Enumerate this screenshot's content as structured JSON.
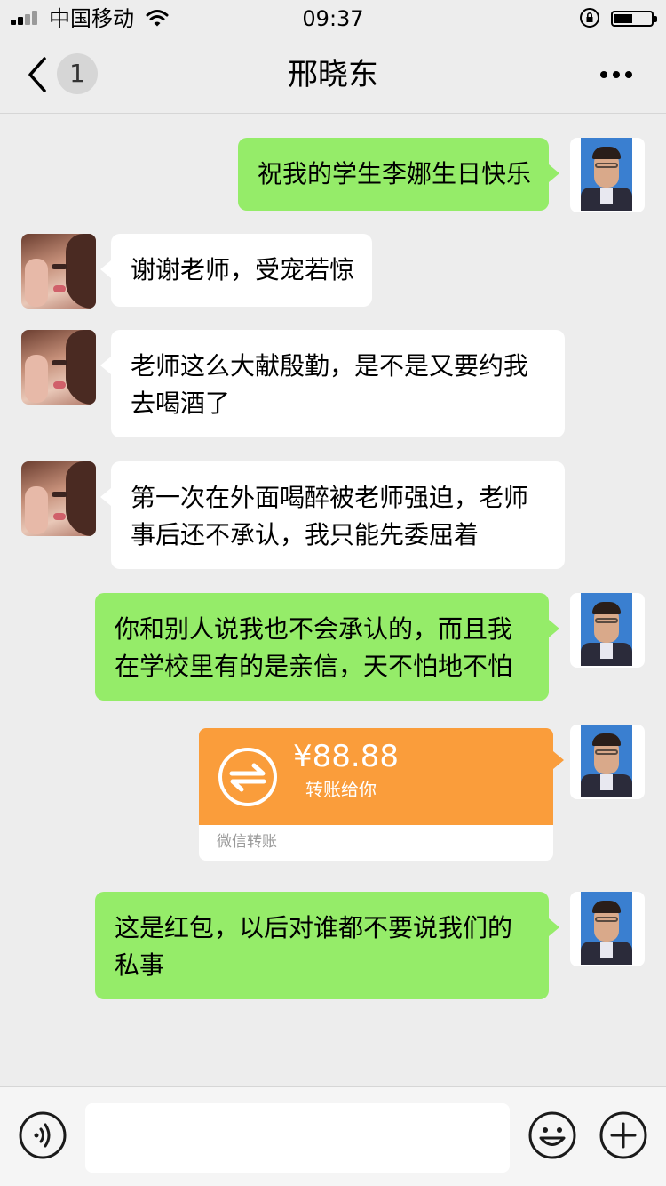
{
  "status_bar": {
    "carrier": "中国移动",
    "time": "09:37",
    "battery_level": 0.5
  },
  "nav": {
    "unread_count": "1",
    "title": "邢晓东",
    "icons": [
      "back-chevron-icon",
      "more-dots-icon"
    ]
  },
  "messages": [
    {
      "from": "me",
      "text": "祝我的学生李娜生日快乐"
    },
    {
      "from": "contact",
      "text": "谢谢老师，受宠若惊"
    },
    {
      "from": "contact",
      "text": "老师这么大献殷勤，是不是又要约我去喝酒了"
    },
    {
      "from": "contact",
      "text": "第一次在外面喝醉被老师强迫，老师事后还不承认，我只能先委屈着"
    },
    {
      "from": "me",
      "text": "你和别人说我也不会承认的，而且我在学校里有的是亲信，天不怕地不怕"
    },
    {
      "from": "me",
      "type": "transfer",
      "amount": "¥88.88",
      "note": "转账给你",
      "source": "微信转账"
    },
    {
      "from": "me",
      "text": "这是红包，以后对谁都不要说我们的私事"
    }
  ],
  "input_bar": {
    "value": "",
    "icons": [
      "voice-icon",
      "emoji-icon",
      "plus-icon"
    ]
  },
  "colors": {
    "background": "#ededed",
    "my_bubble": "#95ec69",
    "their_bubble": "#ffffff",
    "transfer": "#fa9d3b"
  }
}
